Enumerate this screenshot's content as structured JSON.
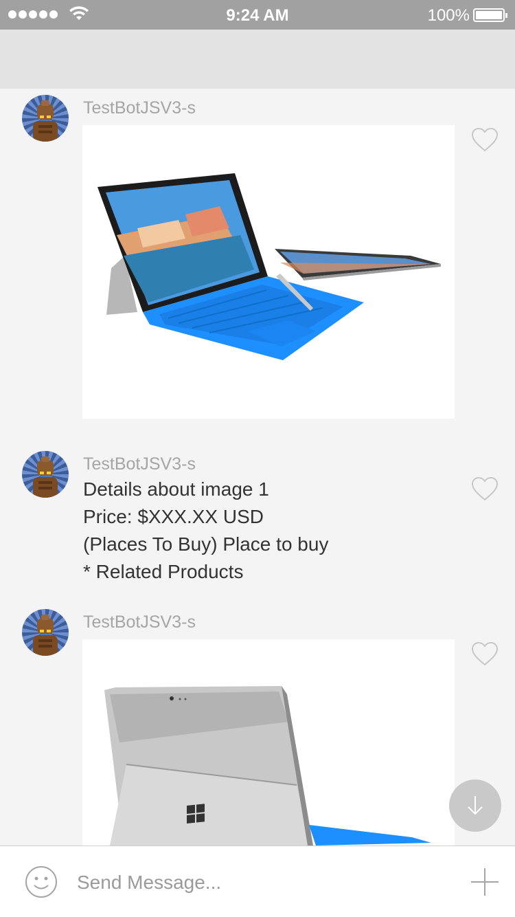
{
  "status_bar": {
    "time": "9:24 AM",
    "battery": "100%",
    "signal_icon": "signal-dots-icon",
    "wifi_icon": "wifi-icon",
    "battery_icon": "battery-icon"
  },
  "chat": {
    "messages": [
      {
        "sender": "TestBotJSV3-s",
        "type": "image",
        "image_icon": "surface-pro-keyboard-image",
        "like_icon": "heart-icon"
      },
      {
        "sender": "TestBotJSV3-s",
        "type": "text",
        "lines": [
          "Details about image 1",
          "Price: $XXX.XX USD",
          "(Places To Buy) Place to buy",
          "* Related Products"
        ],
        "like_icon": "heart-icon"
      },
      {
        "sender": "TestBotJSV3-s",
        "type": "image",
        "image_icon": "surface-pro-back-image",
        "like_icon": "heart-icon"
      }
    ],
    "scroll_down_icon": "arrow-down-icon"
  },
  "composer": {
    "placeholder": "Send Message...",
    "value": "",
    "emoji_icon": "smiley-icon",
    "add_icon": "plus-icon"
  },
  "colors": {
    "status_bar": "#a1a1a1",
    "header": "#e3e3e3",
    "background": "#f4f4f4",
    "accent_keyboard": "#1e90ff"
  }
}
